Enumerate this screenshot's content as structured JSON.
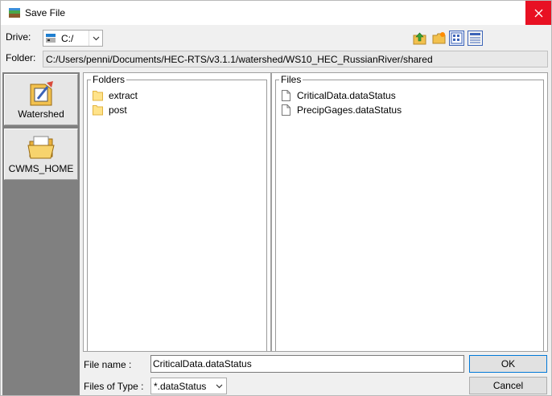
{
  "window": {
    "title": "Save File",
    "close_icon": "close-icon"
  },
  "drive": {
    "label": "Drive:",
    "value": "C:/"
  },
  "folder": {
    "label": "Folder:",
    "path": "C:/Users/penni/Documents/HEC-RTS/v3.1.1/watershed/WS10_HEC_RussianRiver/shared"
  },
  "toolbar": [
    "up-folder-icon",
    "new-folder-icon",
    "list-view-icon",
    "details-view-icon"
  ],
  "places": [
    {
      "label": "Watershed",
      "icon": "watershed-icon"
    },
    {
      "label": "CWMS_HOME",
      "icon": "open-folder-icon"
    }
  ],
  "folders": {
    "legend": "Folders",
    "items": [
      "extract",
      "post"
    ]
  },
  "files": {
    "legend": "Files",
    "items": [
      "CriticalData.dataStatus",
      "PrecipGages.dataStatus"
    ]
  },
  "file_name": {
    "label": "File name :",
    "value": "CriticalData.dataStatus"
  },
  "file_type": {
    "label": "Files of Type :",
    "value": "*.dataStatus"
  },
  "buttons": {
    "ok": "OK",
    "cancel": "Cancel"
  },
  "colors": {
    "close": "#e81123",
    "places_bg": "#808080",
    "folder": "#ffe38a",
    "default_button": "#0078d7"
  }
}
